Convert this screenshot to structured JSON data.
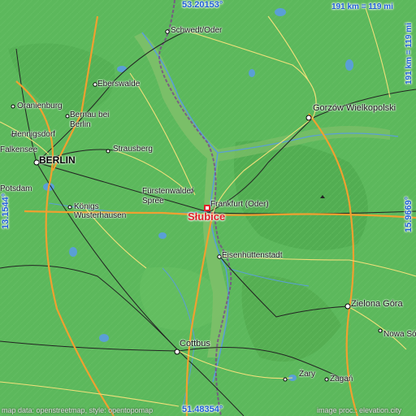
{
  "map": {
    "focus_place": "Słubice",
    "coordinates": {
      "top": "53.20153°",
      "bottom": "51.48354°",
      "left": "13.1544°",
      "right": "15.9669°"
    },
    "scale": "191 km = 119 mi",
    "places": [
      {
        "name": "Schwedt/Oder"
      },
      {
        "name": "Eberswalde"
      },
      {
        "name": "Oranienburg"
      },
      {
        "name": "Bernau bei"
      },
      {
        "name": "Berlin"
      },
      {
        "name": "Hennigsdorf"
      },
      {
        "name": "Falkensee"
      },
      {
        "name": "BERLIN"
      },
      {
        "name": "Strausberg"
      },
      {
        "name": "Potsdam"
      },
      {
        "name": "Gorzów Wielkopolski"
      },
      {
        "name": "Fürstenwalde/"
      },
      {
        "name": "Spree"
      },
      {
        "name": "Frankfurt (Oder)"
      },
      {
        "name": "Königs"
      },
      {
        "name": "Wusterhausen"
      },
      {
        "name": "Eisenhüttenstadt"
      },
      {
        "name": "Zielona Góra"
      },
      {
        "name": "Nowa Sól"
      },
      {
        "name": "Cottbus"
      },
      {
        "name": "Żary"
      },
      {
        "name": "Żagań"
      }
    ],
    "attribution_left": "map data: openstreetmap, style: opentopomap",
    "attribution_right": "image proc.: elevation.city",
    "colors": {
      "lowland": "#5cb85c",
      "upland": "#4aa84a",
      "river_valley": "#7fbf6a",
      "road_major": "#f0a030",
      "road_minor": "#f3e07a",
      "rail": "#222222",
      "water": "#5a9fd6",
      "border": "#7a4a8a",
      "focus_marker": "#e0202a",
      "coordinate_text": "#1f5fd6"
    }
  }
}
